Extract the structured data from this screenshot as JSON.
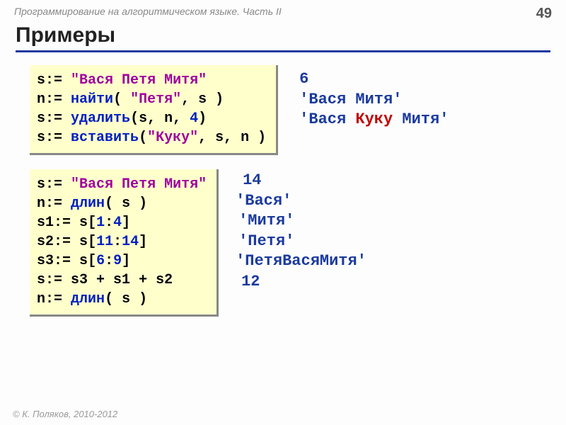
{
  "header": {
    "course": "Программирование на алгоритмическом языке. Часть II",
    "page": "49"
  },
  "title": "Примеры",
  "block1": {
    "l1_v": "s",
    "l1_op": ":=",
    "l1_str": "\"Вася Петя Митя\"",
    "l2_v": "n",
    "l2_op": ":=",
    "l2_fn": "найти",
    "l2_a1": "\"Петя\"",
    "l2_a2": "s",
    "l3_v": "s",
    "l3_op": ":=",
    "l3_fn": "удалить",
    "l3_a1": "s",
    "l3_a2": "n",
    "l3_a3": "4",
    "l4_v": "s",
    "l4_op": ":=",
    "l4_fn": "вставить",
    "l4_a1": "\"Куку\"",
    "l4_a2": "s",
    "l4_a3": "n"
  },
  "result1": {
    "r1": "6",
    "r2": "'Вася  Митя'",
    "r3a": "'Вася ",
    "r3b": "Куку",
    "r3c": " Митя'"
  },
  "block2": {
    "l1_v": "s",
    "l1_op": ":=",
    "l1_str": "\"Вася Петя Митя\"",
    "l2_v": "n",
    "l2_op": ":=",
    "l2_fn": "длин",
    "l2_a1": "s",
    "l3_v": "s1",
    "l3_op": ":=",
    "l3_a1": "s",
    "l3_n1": "1",
    "l3_n2": "4",
    "l4_v": "s2",
    "l4_op": ":=",
    "l4_a1": "s",
    "l4_n1": "11",
    "l4_n2": "14",
    "l5_v": "s3",
    "l5_op": ":=",
    "l5_a1": "s",
    "l5_n1": "6",
    "l5_n2": "9",
    "l6_v": "s",
    "l6_op": ":=",
    "l6_expr": "s3 + s1 + s2",
    "l7_v": "n",
    "l7_op": ":=",
    "l7_fn": "длин",
    "l7_a1": "s"
  },
  "result2": {
    "r1": "14",
    "r2": "'Вася'",
    "r3": "'Митя'",
    "r4": "'Петя'",
    "r5": "'ПетяВасяМитя'",
    "r6": "12"
  },
  "footer": "© К. Поляков, 2010-2012"
}
